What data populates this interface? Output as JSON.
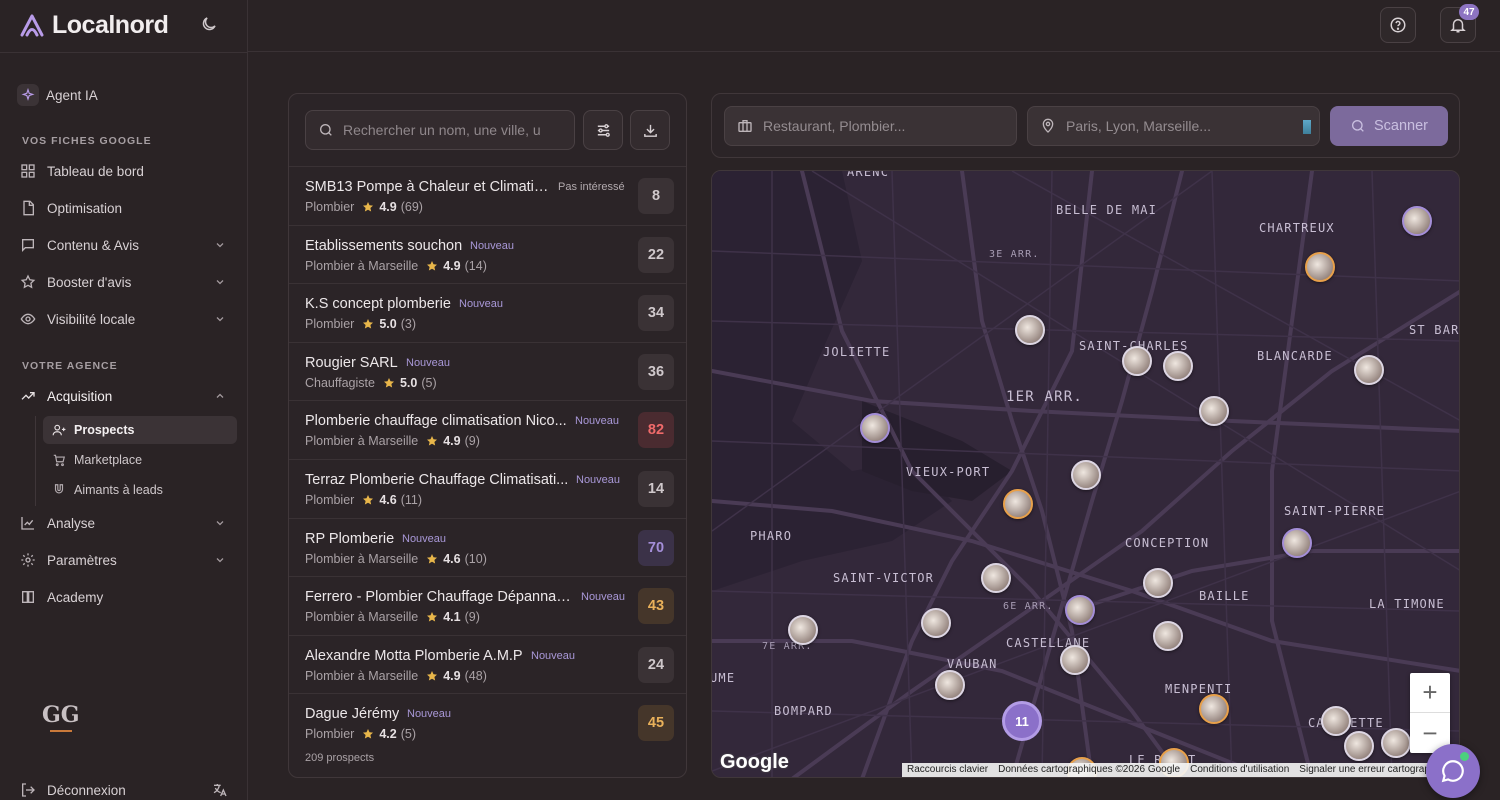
{
  "app": {
    "name": "Localnord"
  },
  "header": {
    "notifications_count": "47"
  },
  "sidebar": {
    "agent": "Agent IA",
    "section1": "VOS FICHES GOOGLE",
    "items1": [
      {
        "label": "Tableau de bord"
      },
      {
        "label": "Optimisation"
      },
      {
        "label": "Contenu & Avis"
      },
      {
        "label": "Booster d'avis"
      },
      {
        "label": "Visibilité locale"
      }
    ],
    "section2": "VOTRE AGENCE",
    "acquisition": "Acquisition",
    "subitems": [
      {
        "label": "Prospects"
      },
      {
        "label": "Marketplace"
      },
      {
        "label": "Aimants à leads"
      }
    ],
    "items2": [
      {
        "label": "Analyse"
      },
      {
        "label": "Paramètres"
      },
      {
        "label": "Academy"
      }
    ],
    "footer_logo": "GG",
    "logout": "Déconnexion"
  },
  "list": {
    "search_placeholder": "Rechercher un nom, une ville, u",
    "count": "209 prospects",
    "prospects": [
      {
        "name": "SMB13 Pompe à Chaleur et Climatis...",
        "status": "Pas intéressé",
        "category": "Plombier",
        "rating": "4.9",
        "reviews": "(69)",
        "score": "8"
      },
      {
        "name": "Etablissements souchon",
        "status": "Nouveau",
        "category": "Plombier à Marseille",
        "rating": "4.9",
        "reviews": "(14)",
        "score": "22"
      },
      {
        "name": "K.S concept plomberie",
        "status": "Nouveau",
        "category": "Plombier",
        "rating": "5.0",
        "reviews": "(3)",
        "score": "34"
      },
      {
        "name": "Rougier SARL",
        "status": "Nouveau",
        "category": "Chauffagiste",
        "rating": "5.0",
        "reviews": "(5)",
        "score": "36"
      },
      {
        "name": "Plomberie chauffage climatisation Nico...",
        "status": "Nouveau",
        "category": "Plombier à Marseille",
        "rating": "4.9",
        "reviews": "(9)",
        "score": "82"
      },
      {
        "name": "Terraz Plomberie Chauffage Climatisati...",
        "status": "Nouveau",
        "category": "Plombier",
        "rating": "4.6",
        "reviews": "(11)",
        "score": "14"
      },
      {
        "name": "RP Plomberie",
        "status": "Nouveau",
        "category": "Plombier à Marseille",
        "rating": "4.6",
        "reviews": "(10)",
        "score": "70"
      },
      {
        "name": "Ferrero - Plombier Chauffage Dépannag...",
        "status": "Nouveau",
        "category": "Plombier à Marseille",
        "rating": "4.1",
        "reviews": "(9)",
        "score": "43"
      },
      {
        "name": "Alexandre Motta Plomberie A.M.P",
        "status": "Nouveau",
        "category": "Plombier à Marseille",
        "rating": "4.9",
        "reviews": "(48)",
        "score": "24"
      },
      {
        "name": "Dague Jérémy",
        "status": "Nouveau",
        "category": "Plombier",
        "rating": "4.2",
        "reviews": "(5)",
        "score": "45"
      }
    ]
  },
  "scan": {
    "business_placeholder": "Restaurant, Plombier...",
    "city_placeholder": "Paris, Lyon, Marseille...",
    "button": "Scanner"
  },
  "map": {
    "labels": [
      "BELLE DE MAI",
      "CHARTREUX",
      "3E ARR.",
      "JOLIETTE",
      "SAINT-CHARLES",
      "BLANCARDE",
      "ST BARN",
      "1ER ARR.",
      "VIEUX-PORT",
      "SAINT-PIERRE",
      "PHARO",
      "CONCEPTION",
      "SAINT-VICTOR",
      "6E ARR.",
      "BAILLE",
      "LA TIMONE",
      "7E ARR.",
      "CASTELLANE",
      "VAUBAN",
      "UME",
      "BOMPARD",
      "MENPENTI",
      "CAPELETTE",
      "LE ROUET",
      "ARENC"
    ],
    "cluster": "11",
    "google": "Google",
    "attribution": [
      "Raccourcis clavier",
      "Données cartographiques ©2026 Google",
      "Conditions d'utilisation",
      "Signaler une erreur cartographique"
    ]
  },
  "colors": {
    "accent": "#8b70c9",
    "score_red": "#ef6a6a",
    "score_purple": "#a48ed8",
    "score_orange": "#e9b15a",
    "score_gray": "#cfc8cb"
  }
}
